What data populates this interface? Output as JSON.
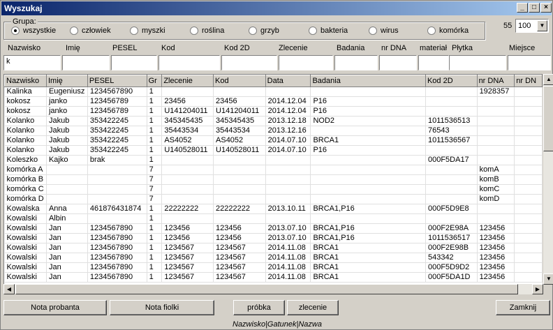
{
  "window": {
    "title": "Wyszukaj"
  },
  "group": {
    "label": "Grupa:",
    "options": [
      "wszystkie",
      "człowiek",
      "myszki",
      "roślina",
      "grzyb",
      "bakteria",
      "wirus",
      "komórka"
    ],
    "selected_index": 0
  },
  "limit": {
    "count": "55",
    "selected": "100"
  },
  "filters": {
    "labels": [
      "Nazwisko",
      "Imię",
      "PESEL",
      "Kod",
      "Kod 2D",
      "Zlecenie",
      "Badania",
      "nr DNA",
      "materiał",
      "Płytka",
      "Miejsce"
    ],
    "nazwisko_value": "k"
  },
  "table": {
    "columns": [
      "Nazwisko",
      "Imię",
      "PESEL",
      "Gr",
      "Zlecenie",
      "Kod",
      "Data",
      "Badania",
      "Kod 2D",
      "nr DNA",
      "nr DN"
    ],
    "rows": [
      [
        "Kalinka",
        "Eugeniusz",
        "1234567890",
        "1",
        "",
        "",
        "",
        "",
        "",
        "1928357",
        ""
      ],
      [
        "kokosz",
        "janko",
        "123456789",
        "1",
        "23456",
        "23456",
        "2014.12.04",
        "P16",
        "",
        "",
        ""
      ],
      [
        "kokosz",
        "janko",
        "123456789",
        "1",
        "U141204011",
        "U141204011",
        "2014.12.04",
        "P16",
        "",
        "",
        ""
      ],
      [
        "Kolanko",
        "Jakub",
        "353422245",
        "1",
        "345345435",
        "345345435",
        "2013.12.18",
        "NOD2",
        "1011536513",
        "",
        ""
      ],
      [
        "Kolanko",
        "Jakub",
        "353422245",
        "1",
        "35443534",
        "35443534",
        "2013.12.16",
        "",
        "76543",
        "",
        ""
      ],
      [
        "Kolanko",
        "Jakub",
        "353422245",
        "1",
        "AS4052",
        "AS4052",
        "2014.07.10",
        "BRCA1",
        "1011536567",
        "",
        ""
      ],
      [
        "Kolanko",
        "Jakub",
        "353422245",
        "1",
        "U140528011",
        "U140528011",
        "2014.07.10",
        "P16",
        "",
        "",
        ""
      ],
      [
        "Koleszko",
        "Kajko",
        "brak",
        "1",
        "",
        "",
        "",
        "",
        "000F5DA17",
        "",
        ""
      ],
      [
        "komórka A",
        "",
        "",
        "7",
        "",
        "",
        "",
        "",
        "",
        "komA",
        ""
      ],
      [
        "komórka B",
        "",
        "",
        "7",
        "",
        "",
        "",
        "",
        "",
        "komB",
        ""
      ],
      [
        "komórka C",
        "",
        "",
        "7",
        "",
        "",
        "",
        "",
        "",
        "komC",
        ""
      ],
      [
        "komórka D",
        "",
        "",
        "7",
        "",
        "",
        "",
        "",
        "",
        "komD",
        ""
      ],
      [
        "Kowalska",
        "Anna",
        "461876431874",
        "1",
        "22222222",
        "22222222",
        "2013.10.11",
        "BRCA1,P16",
        "000F5D9E8",
        "",
        ""
      ],
      [
        "Kowalski",
        "Albin",
        "",
        "1",
        "",
        "",
        "",
        "",
        "",
        "",
        ""
      ],
      [
        "Kowalski",
        "Jan",
        "1234567890",
        "1",
        "123456",
        "123456",
        "2013.07.10",
        "BRCA1,P16",
        "000F2E98A",
        "123456",
        ""
      ],
      [
        "Kowalski",
        "Jan",
        "1234567890",
        "1",
        "123456",
        "123456",
        "2013.07.10",
        "BRCA1,P16",
        "1011536517",
        "123456",
        ""
      ],
      [
        "Kowalski",
        "Jan",
        "1234567890",
        "1",
        "1234567",
        "1234567",
        "2014.11.08",
        "BRCA1",
        "000F2E98B",
        "123456",
        ""
      ],
      [
        "Kowalski",
        "Jan",
        "1234567890",
        "1",
        "1234567",
        "1234567",
        "2014.11.08",
        "BRCA1",
        "543342",
        "123456",
        ""
      ],
      [
        "Kowalski",
        "Jan",
        "1234567890",
        "1",
        "1234567",
        "1234567",
        "2014.11.08",
        "BRCA1",
        "000F5D9D2",
        "123456",
        ""
      ],
      [
        "Kowalski",
        "Jan",
        "1234567890",
        "1",
        "1234567",
        "1234567",
        "2014.11.08",
        "BRCA1",
        "000F5DA1D",
        "123456",
        ""
      ]
    ]
  },
  "buttons": {
    "nota_probanta": "Nota probanta",
    "nota_fiolki": "Nota fiolki",
    "probka": "próbka",
    "zlecenie": "zlecenie",
    "zamknij": "Zamknij"
  },
  "status": {
    "hint": "Nazwisko|Gatunek|Nazwa"
  }
}
